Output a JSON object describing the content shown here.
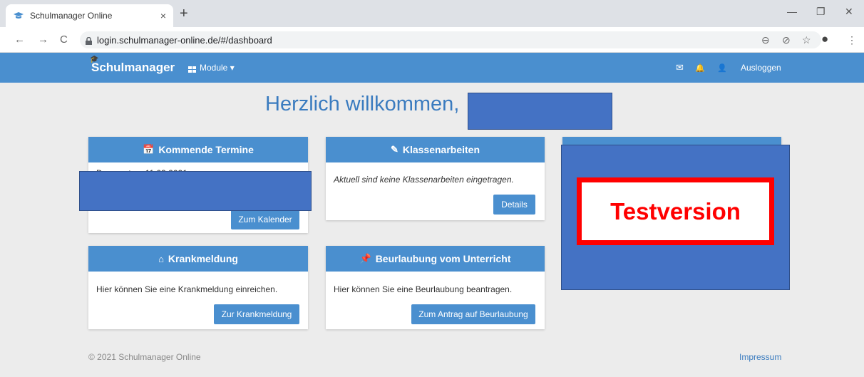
{
  "browser": {
    "tab_title": "Schulmanager Online",
    "tab_close": "×",
    "new_tab": "+",
    "url": "login.schulmanager-online.de/#/dashboard",
    "back": "←",
    "forward": "→",
    "reload": "C",
    "minimize": "—",
    "restore": "❐",
    "close": "✕",
    "zoom_icon": "⊖",
    "eye_icon": "⊘",
    "star_icon": "☆",
    "profile_icon": "●",
    "menu_icon": "⋮"
  },
  "navbar": {
    "brand": "Schulmanager",
    "brand_cap": "🎓",
    "module_label": "Module ▾",
    "mail_icon": "✉",
    "bell_icon": "🔔",
    "user_icon": "👤",
    "logout": "Ausloggen"
  },
  "main": {
    "welcome": "Herzlich willkommen,",
    "cards": {
      "termine": {
        "icon": "📅",
        "title": "Kommende Termine",
        "partial_text": "Donnerstag, 11.03.2021",
        "button": "Zum Kalender"
      },
      "klassenarbeiten": {
        "icon": "✎",
        "title": "Klassenarbeiten",
        "text": "Aktuell sind keine Klassenarbeiten eingetragen.",
        "button": "Details"
      },
      "krank": {
        "icon": "⌂",
        "title": "Krankmeldung",
        "text": "Hier können Sie eine Krankmeldung einreichen.",
        "button": "Zur Krankmeldung"
      },
      "beurlaubung": {
        "icon": "📌",
        "title": "Beurlaubung vom Unterricht",
        "text": "Hier können Sie eine Beurlaubung beantragen.",
        "button": "Zum Antrag auf Beurlaubung"
      }
    },
    "test_label": "Testversion"
  },
  "footer": {
    "copyright": "© 2021 Schulmanager Online",
    "impressum": "Impressum"
  }
}
